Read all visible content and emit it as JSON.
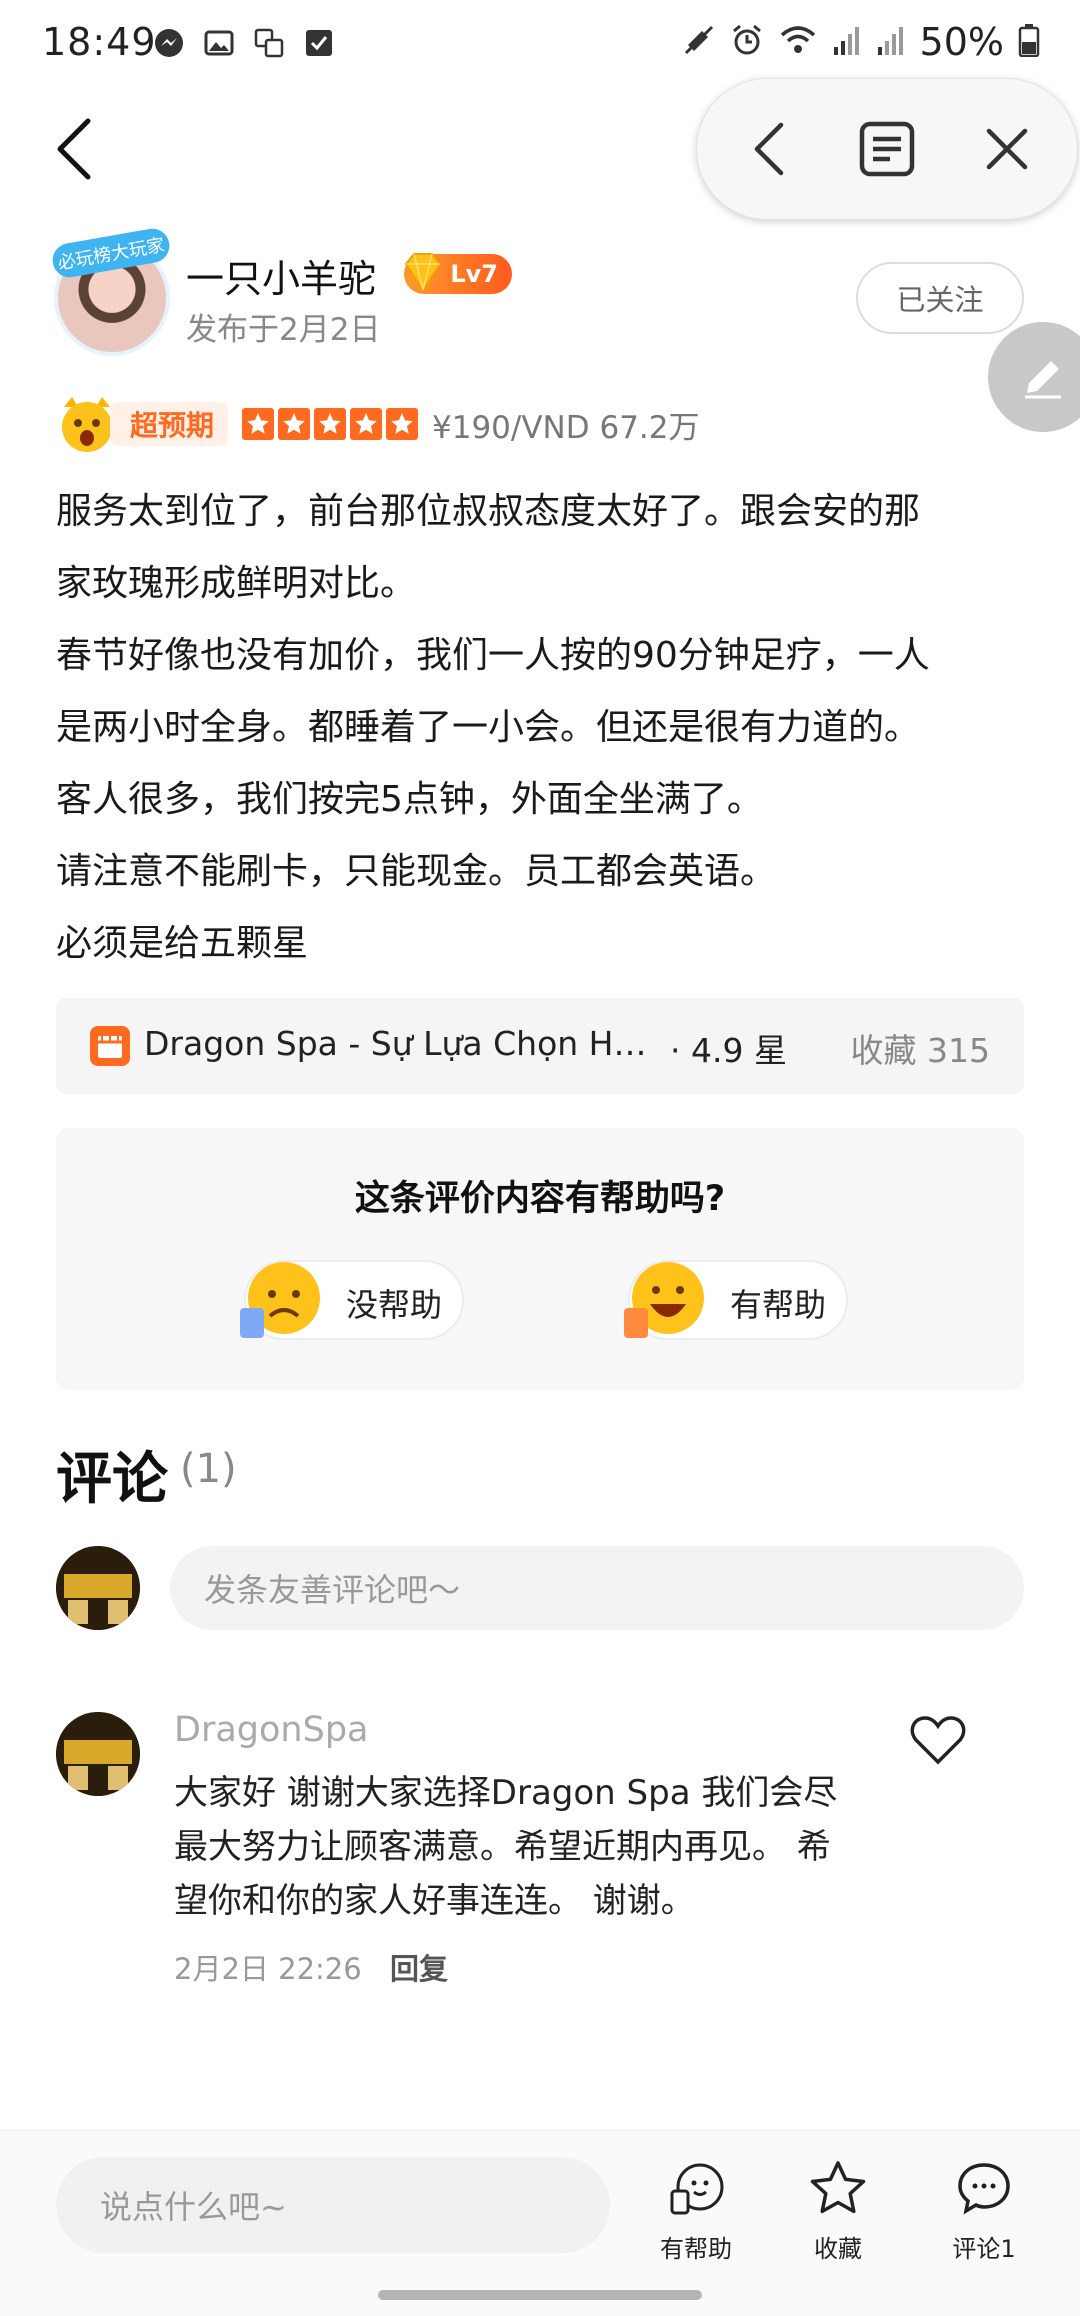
{
  "status_bar": {
    "time": "18:49",
    "battery": "50%",
    "icons_left": [
      "messenger-icon",
      "image-icon",
      "translate-icon",
      "checkbox-icon"
    ],
    "icons_right": [
      "mute-icon",
      "alarm-icon",
      "wifi-icon",
      "signal-icon",
      "signal-icon",
      "battery-icon"
    ]
  },
  "author": {
    "name": "一只小羊驼",
    "level": "Lv7",
    "date": "发布于2月2日",
    "avatar_badge": "必玩榜大玩家",
    "follow_label": "已关注"
  },
  "rating": {
    "tag": "超预期",
    "stars": 5,
    "price": "¥190/VND 67.2万",
    "accent_color": "#ff6a1f"
  },
  "review": {
    "lines": [
      "服务太到位了，前台那位叔叔态度太好了。跟会安的那",
      "家玫瑰形成鲜明对比。",
      "春节好像也没有加价，我们一人按的90分钟足疗，一人",
      "是两小时全身。都睡着了一小会。但还是很有力道的。",
      "客人很多，我们按完5点钟，外面全坐满了。",
      "请注意不能刷卡，只能现金。员工都会英语。",
      "必须是给五颗星"
    ]
  },
  "shop": {
    "name": "Dragon Spa - Sự Lựa Chọn Ho...",
    "rating": "· 4.9 星",
    "favorites": "收藏 315"
  },
  "helpful": {
    "question": "这条评价内容有帮助吗?",
    "no_label": "没帮助",
    "yes_label": "有帮助"
  },
  "comments": {
    "title": "评论",
    "count": "(1)",
    "input_placeholder": "发条友善评论吧～",
    "items": [
      {
        "author": "DragonSpa",
        "lines": [
          "大家好 谢谢大家选择Dragon Spa 我们会尽",
          "最大努力让顾客满意。希望近期内再见。 希",
          "望你和你的家人好事连连。 谢谢。"
        ],
        "time": "2月2日  22:26",
        "reply_label": "回复"
      }
    ]
  },
  "bottom_bar": {
    "input_placeholder": "说点什么吧~",
    "helpful_label": "有帮助",
    "favorite_label": "收藏",
    "comment_label": "评论1"
  }
}
